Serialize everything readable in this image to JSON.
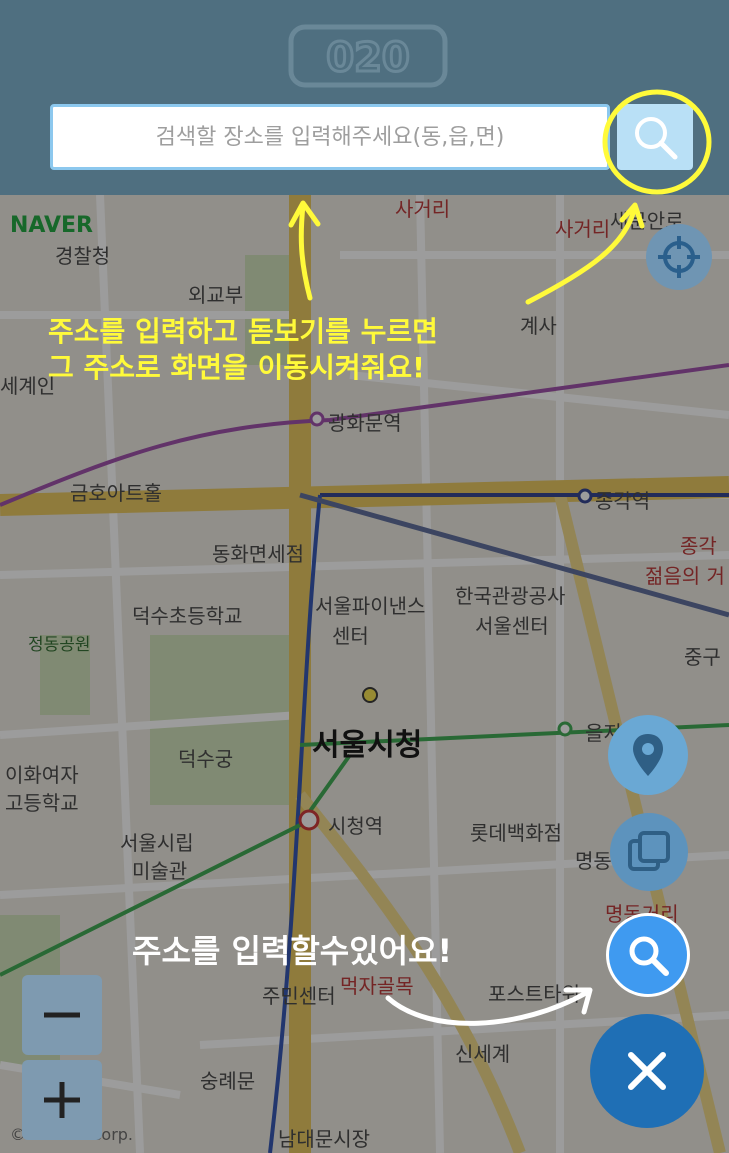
{
  "header": {
    "logo_text": "020",
    "search": {
      "placeholder": "검색할 장소를 입력해주세요(동,읍,면)"
    }
  },
  "map": {
    "provider": "NAVER",
    "copyright": "© NAVER Corp.",
    "labels": {
      "police": "경찰청",
      "foreign_ministry": "외교부",
      "sejong": "세계인",
      "gwanghwamun": "광화문역",
      "kumho": "금호아트홀",
      "jonggak": "종각역",
      "donghwa": "동화면세점",
      "seoul_finance": "서울파이낸스",
      "center": "센터",
      "korea_tourism": "한국관광공사",
      "seoul_center": "서울센터",
      "deoksu_school": "덕수초등학교",
      "jeongdong_park": "정동공원",
      "seoul_cityhall": "서울시청",
      "deoksugung": "덕수궁",
      "ewha1": "이화여자",
      "ewha2": "고등학교",
      "cityhall_station": "시청역",
      "lotte": "롯데백화점",
      "museum1": "서울시립",
      "museum2": "미술관",
      "myeongdong": "명동",
      "myeongdong_street": "명동거리",
      "euljiro": "을지",
      "junggu": "중구",
      "jonggak_youth": "종각",
      "youth_street": "젊음의 거",
      "residents_center": "주민센터",
      "meokja": "먹자골목",
      "post_tower": "포스트타워",
      "shinsegae": "신세계",
      "sungnyemun": "숭례문",
      "namdaemun": "남대문시장",
      "sagori": "사거리",
      "sajo": "사거리",
      "gyesa": "계사",
      "saemunan": "새문안로"
    }
  },
  "annotations": {
    "top_line1": "주소를 입력하고 돋보기를 누르면",
    "top_line2": "그 주소로 화면을 이동시켜줘요!",
    "bottom": "주소를 입력할수있어요!"
  },
  "colors": {
    "header_bg": "#4f6f80",
    "search_border": "#8cc8ee",
    "annotation_yellow": "#fffa3a",
    "fab_search": "#3f9af0",
    "fab_close": "#1f6fb5"
  },
  "icons": {
    "search_button": "magnifier-icon",
    "location": "map-pin-icon",
    "layers": "layers-icon",
    "close": "close-icon",
    "gps": "crosshair-icon",
    "zoom_in": "plus-icon",
    "zoom_out": "minus-icon"
  }
}
